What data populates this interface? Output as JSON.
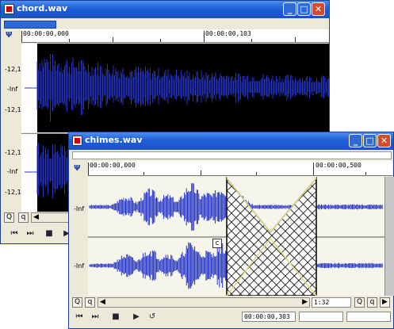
{
  "chord_window": {
    "title": "chord.wav",
    "ruler": {
      "start": "00:00:00,000",
      "mid": "00:00:00,103"
    },
    "levels_ch1": [
      "-12,1",
      "-Inf",
      "-12,1"
    ],
    "levels_ch2": [
      "-12,1",
      "-Inf",
      "-12,1"
    ],
    "colors": {
      "wave": "#2433c4",
      "lane_bg": "#000000"
    }
  },
  "chimes_window": {
    "title": "chimes.wav",
    "ruler": {
      "start": "00:00:00,000",
      "mid": "00:00:00,500"
    },
    "levels_ch1": [
      "-Inf"
    ],
    "levels_ch2": [
      "-Inf"
    ],
    "fade_marker": "C",
    "zoom_value": "1:32",
    "position_time": "00:00:00,303",
    "colors": {
      "wave": "#2433c4",
      "lane_bg": "#f5f5eb",
      "selection": "#000000",
      "envelope": "#e0d880"
    }
  },
  "window_buttons": {
    "minimize": "_",
    "maximize": "□",
    "close": "✕"
  },
  "transport_icons": [
    "go-to-start-icon",
    "go-to-end-icon",
    "stop-icon",
    "play-icon",
    "loop-icon"
  ],
  "icons": {
    "marker": "marker-icon",
    "zoom_in": "zoom-in-icon",
    "zoom_out": "zoom-out-icon"
  }
}
